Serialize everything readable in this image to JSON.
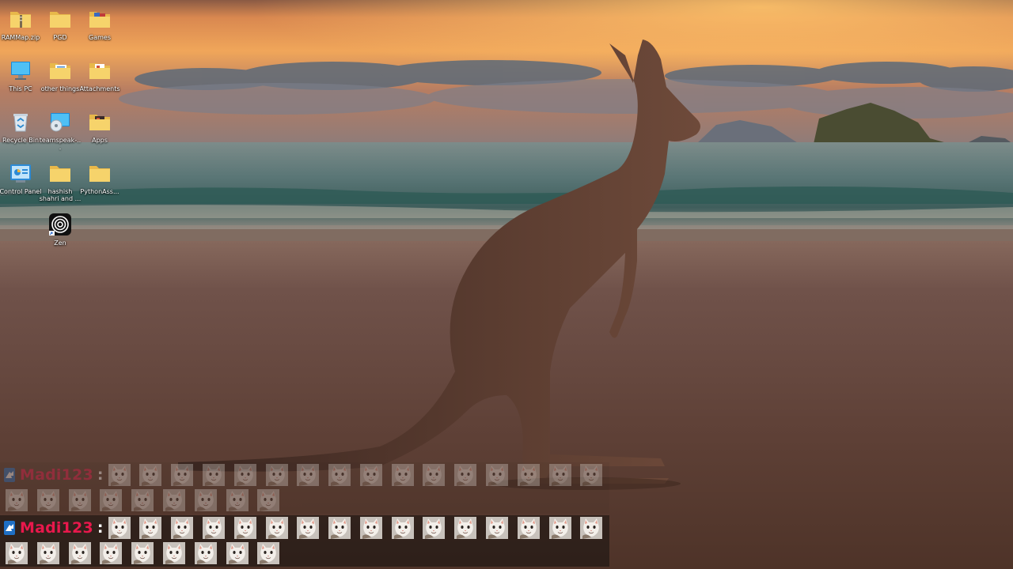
{
  "desktop": {
    "icons": [
      {
        "label": "RAMMap.zip",
        "icon": "zip-folder-icon"
      },
      {
        "label": "PGD",
        "icon": "folder-icon"
      },
      {
        "label": "Games",
        "icon": "folder-icon"
      },
      {
        "label": "This PC",
        "icon": "monitor-icon"
      },
      {
        "label": "other things",
        "icon": "folder-icon"
      },
      {
        "label": "Attachments",
        "icon": "folder-icon"
      },
      {
        "label": "Recycle Bin",
        "icon": "recycle-bin-icon"
      },
      {
        "label": "teamspeak-...",
        "icon": "installer-icon"
      },
      {
        "label": "Apps",
        "icon": "folder-icon"
      },
      {
        "label": "Control Panel",
        "icon": "control-panel-icon"
      },
      {
        "label": "hashish shahri and ...",
        "icon": "folder-icon"
      },
      {
        "label": "PythonAss...",
        "icon": "folder-icon"
      },
      {
        "label": "Zen",
        "icon": "zen-app-icon"
      }
    ]
  },
  "chat": {
    "messages": [
      {
        "username": "Madi123",
        "separator": ":",
        "emote_count": 25,
        "faded": true,
        "platform_icon": "twitch-icon"
      },
      {
        "username": "Madi123",
        "separator": ":",
        "emote_count": 25,
        "faded": false,
        "platform_icon": "twitch-icon"
      }
    ],
    "emote_name": "cat-emote-icon",
    "username_color": "#e8184c"
  },
  "colors": {
    "sky_top": "#6e4a3a",
    "sky_glow": "#f0a050",
    "sea": "#5e7a7a",
    "sand": "#6a4a3c"
  }
}
